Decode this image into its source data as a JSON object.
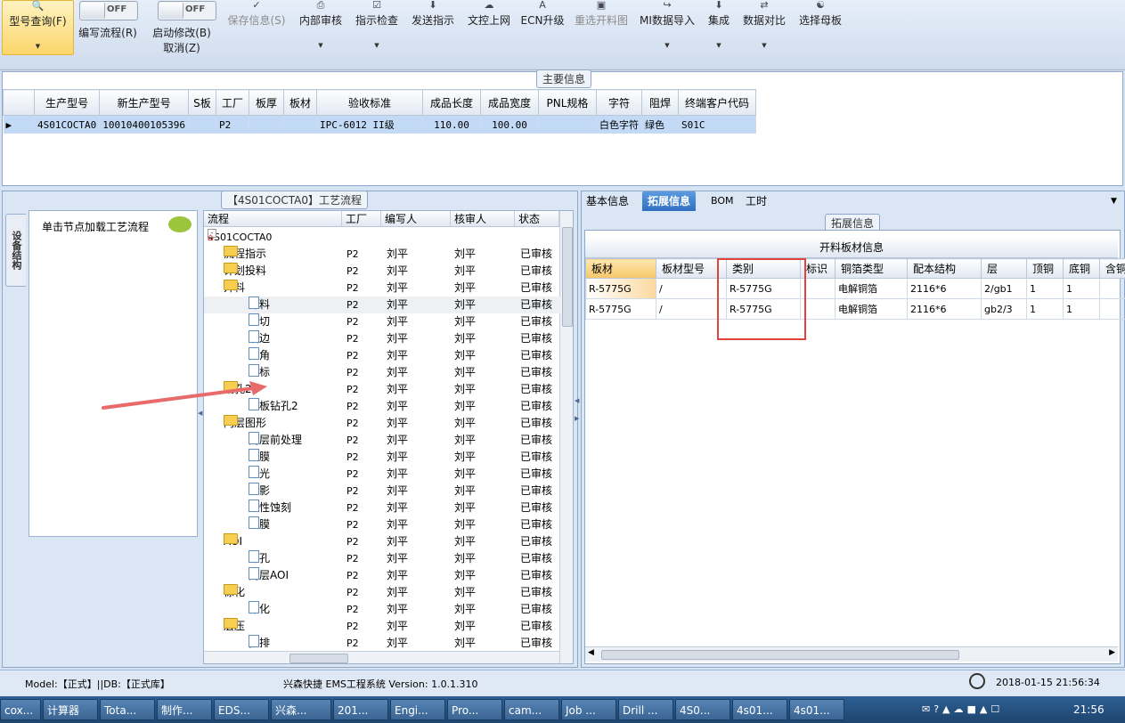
{
  "ribbon": {
    "items": [
      {
        "label": "型号查询(F)"
      },
      {
        "label": "编写流程(R)",
        "toggle": "OFF"
      },
      {
        "label": "启动修改(B)",
        "label2": "取消(Z)",
        "toggle": "OFF"
      },
      {
        "label": "保存信息(S)"
      },
      {
        "label": "内部审核"
      },
      {
        "label": "指示检查"
      },
      {
        "label": "发送指示"
      },
      {
        "label": "文控上网"
      },
      {
        "label": "ECN升级"
      },
      {
        "label": "重选开料图"
      },
      {
        "label": "MI数据导入"
      },
      {
        "label": "集成"
      },
      {
        "label": "数据对比"
      },
      {
        "label": "选择母板"
      }
    ]
  },
  "main_info": {
    "title": "主要信息",
    "columns": [
      "生产型号",
      "新生产型号",
      "S板",
      "工厂",
      "板厚",
      "板材",
      "验收标准",
      "成品长度",
      "成品宽度",
      "PNL规格",
      "字符",
      "阻焊",
      "终端客户代码"
    ],
    "row": [
      "4S01COCTA0",
      "10010400105396",
      "",
      "P2",
      "",
      "",
      "IPC-6012 II级",
      "110.00",
      "100.00",
      "",
      "白色字符",
      "绿色",
      "S01C"
    ]
  },
  "process": {
    "title": "【4S01COCTA0】工艺流程",
    "side_tab": "设备结构",
    "hint": "单击节点加载工艺流程",
    "columns": [
      "流程",
      "工厂",
      "编写人",
      "核审人",
      "状态"
    ],
    "root": "4S01COCTA0",
    "rows": [
      {
        "name": "流程指示",
        "type": "folder",
        "level": 1,
        "exp": "+",
        "factory": "P2",
        "writer": "刘平",
        "reviewer": "刘平",
        "status": "已审核"
      },
      {
        "name": "计划投料",
        "type": "folder",
        "level": 1,
        "exp": "+",
        "factory": "P2",
        "writer": "刘平",
        "reviewer": "刘平",
        "status": "已审核"
      },
      {
        "name": "开料",
        "type": "folder",
        "level": 1,
        "exp": "-",
        "factory": "P2",
        "writer": "刘平",
        "reviewer": "刘平",
        "status": "已审核"
      },
      {
        "name": "开料",
        "type": "doc",
        "level": 2,
        "factory": "P2",
        "writer": "刘平",
        "reviewer": "刘平",
        "status": "已审核",
        "selected": true
      },
      {
        "name": "裁切",
        "type": "doc",
        "level": 2,
        "factory": "P2",
        "writer": "刘平",
        "reviewer": "刘平",
        "status": "已审核"
      },
      {
        "name": "磨边",
        "type": "doc",
        "level": 2,
        "factory": "P2",
        "writer": "刘平",
        "reviewer": "刘平",
        "status": "已审核"
      },
      {
        "name": "圆角",
        "type": "doc",
        "level": 2,
        "factory": "P2",
        "writer": "刘平",
        "reviewer": "刘平",
        "status": "已审核"
      },
      {
        "name": "打标",
        "type": "doc",
        "level": 2,
        "factory": "P2",
        "writer": "刘平",
        "reviewer": "刘平",
        "status": "已审核"
      },
      {
        "name": "钻孔2",
        "type": "folder",
        "level": 1,
        "exp": "-",
        "factory": "P2",
        "writer": "刘平",
        "reviewer": "刘平",
        "status": "已审核"
      },
      {
        "name": "芯板钻孔2",
        "type": "doc",
        "level": 2,
        "factory": "P2",
        "writer": "刘平",
        "reviewer": "刘平",
        "status": "已审核"
      },
      {
        "name": "内层图形",
        "type": "folder",
        "level": 1,
        "exp": "-",
        "factory": "P2",
        "writer": "刘平",
        "reviewer": "刘平",
        "status": "已审核"
      },
      {
        "name": "内层前处理",
        "type": "doc",
        "level": 2,
        "factory": "P2",
        "writer": "刘平",
        "reviewer": "刘平",
        "status": "已审核"
      },
      {
        "name": "贴膜",
        "type": "doc",
        "level": 2,
        "factory": "P2",
        "writer": "刘平",
        "reviewer": "刘平",
        "status": "已审核"
      },
      {
        "name": "曝光",
        "type": "doc",
        "level": 2,
        "factory": "P2",
        "writer": "刘平",
        "reviewer": "刘平",
        "status": "已审核"
      },
      {
        "name": "显影",
        "type": "doc",
        "level": 2,
        "factory": "P2",
        "writer": "刘平",
        "reviewer": "刘平",
        "status": "已审核"
      },
      {
        "name": "酸性蚀刻",
        "type": "doc",
        "level": 2,
        "factory": "P2",
        "writer": "刘平",
        "reviewer": "刘平",
        "status": "已审核"
      },
      {
        "name": "退膜",
        "type": "doc",
        "level": 2,
        "factory": "P2",
        "writer": "刘平",
        "reviewer": "刘平",
        "status": "已审核"
      },
      {
        "name": "AOI",
        "type": "folder",
        "level": 1,
        "exp": "-",
        "factory": "P2",
        "writer": "刘平",
        "reviewer": "刘平",
        "status": "已审核"
      },
      {
        "name": "冲孔",
        "type": "doc",
        "level": 2,
        "factory": "P2",
        "writer": "刘平",
        "reviewer": "刘平",
        "status": "已审核"
      },
      {
        "name": "内层AOI",
        "type": "doc",
        "level": 2,
        "factory": "P2",
        "writer": "刘平",
        "reviewer": "刘平",
        "status": "已审核"
      },
      {
        "name": "棕化",
        "type": "folder",
        "level": 1,
        "exp": "-",
        "factory": "P2",
        "writer": "刘平",
        "reviewer": "刘平",
        "status": "已审核"
      },
      {
        "name": "棕化",
        "type": "doc",
        "level": 2,
        "factory": "P2",
        "writer": "刘平",
        "reviewer": "刘平",
        "status": "已审核"
      },
      {
        "name": "层压",
        "type": "folder",
        "level": 1,
        "exp": "-",
        "factory": "P2",
        "writer": "刘平",
        "reviewer": "刘平",
        "status": "已审核"
      },
      {
        "name": "预排",
        "type": "doc",
        "level": 2,
        "factory": "P2",
        "writer": "刘平",
        "reviewer": "刘平",
        "status": "已审核"
      }
    ]
  },
  "right": {
    "tabs": [
      "基本信息",
      "拓展信息",
      "BOM",
      "工时"
    ],
    "active_tab": "拓展信息",
    "section_title": "拓展信息",
    "table_title": "开料板材信息",
    "columns": [
      "板材",
      "板材型号",
      "类别",
      "标识",
      "铜箔类型",
      "配本结构",
      "层",
      "顶铜",
      "底铜",
      "含铜"
    ],
    "rows": [
      [
        "R-5775G",
        "/",
        "R-5775G",
        "",
        "电解铜箔",
        "2116*6",
        "2/gb1",
        "1",
        "1",
        ""
      ],
      [
        "R-5775G",
        "/",
        "R-5775G",
        "",
        "电解铜箔",
        "2116*6",
        "gb2/3",
        "1",
        "1",
        ""
      ]
    ]
  },
  "status": {
    "model": "Model:【正式】||DB:【正式库】",
    "system": "兴森快捷 EMS工程系统 Version: 1.0.1.310",
    "datetime": "2018-01-15 21:56:34"
  },
  "taskbar": {
    "items": [
      "cox...",
      "计算器",
      "Tota...",
      "制作...",
      "EDS...",
      "兴森...",
      "201...",
      "Engi...",
      "Pro...",
      "cam...",
      "Job ...",
      "Drill ...",
      "4S0...",
      "4s01...",
      "4s01..."
    ],
    "clock": "21:56"
  },
  "colors": {
    "accent": "#3a78c2",
    "annotation_box": "#e0443c",
    "arrow": "#e86a6a",
    "selection": "#c2daf6"
  }
}
